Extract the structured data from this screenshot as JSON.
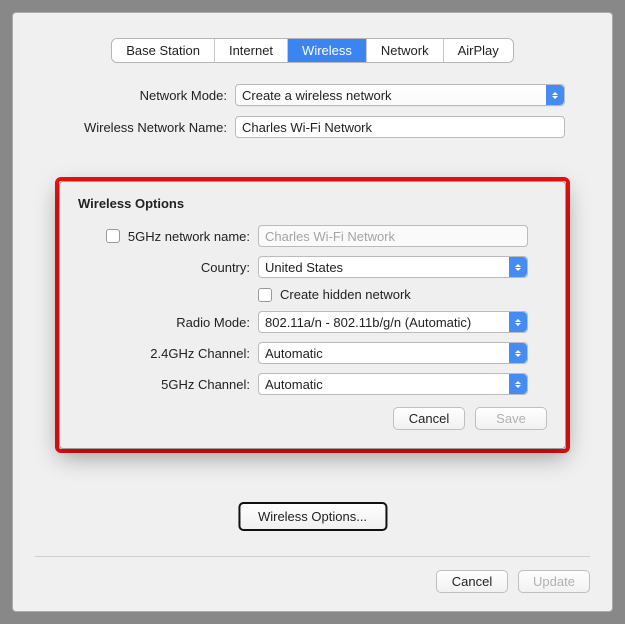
{
  "tabs": [
    "Base Station",
    "Internet",
    "Wireless",
    "Network",
    "AirPlay"
  ],
  "activeTab": "Wireless",
  "main": {
    "networkMode": {
      "label": "Network Mode:",
      "value": "Create a wireless network"
    },
    "networkName": {
      "label": "Wireless Network Name:",
      "value": "Charles Wi-Fi Network"
    }
  },
  "modal": {
    "title": "Wireless Options",
    "ghz5name": {
      "label": "5GHz network name:",
      "value": "Charles Wi-Fi Network"
    },
    "country": {
      "label": "Country:",
      "value": "United States"
    },
    "hidden": {
      "label": "Create hidden network"
    },
    "radio": {
      "label": "Radio Mode:",
      "value": "802.11a/n - 802.11b/g/n (Automatic)"
    },
    "ch24": {
      "label": "2.4GHz Channel:",
      "value": "Automatic"
    },
    "ch5": {
      "label": "5GHz Channel:",
      "value": "Automatic"
    },
    "cancel": "Cancel",
    "save": "Save"
  },
  "optionsBtn": "Wireless Options...",
  "footer": {
    "cancel": "Cancel",
    "update": "Update"
  }
}
